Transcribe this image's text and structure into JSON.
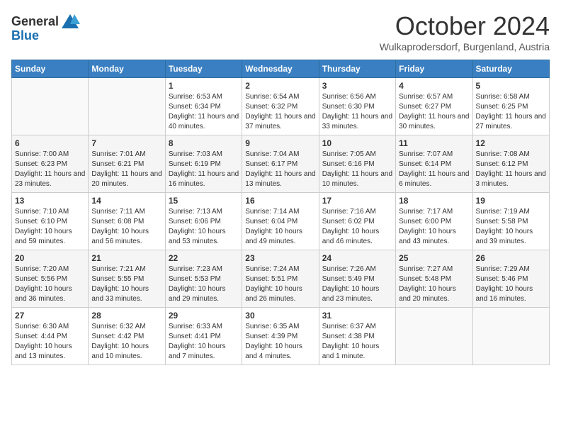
{
  "header": {
    "logo_general": "General",
    "logo_blue": "Blue",
    "month_title": "October 2024",
    "location": "Wulkaprodersdorf, Burgenland, Austria"
  },
  "days_of_week": [
    "Sunday",
    "Monday",
    "Tuesday",
    "Wednesday",
    "Thursday",
    "Friday",
    "Saturday"
  ],
  "weeks": [
    [
      {
        "date": "",
        "sunrise": "",
        "sunset": "",
        "daylight": ""
      },
      {
        "date": "",
        "sunrise": "",
        "sunset": "",
        "daylight": ""
      },
      {
        "date": "1",
        "sunrise": "Sunrise: 6:53 AM",
        "sunset": "Sunset: 6:34 PM",
        "daylight": "Daylight: 11 hours and 40 minutes."
      },
      {
        "date": "2",
        "sunrise": "Sunrise: 6:54 AM",
        "sunset": "Sunset: 6:32 PM",
        "daylight": "Daylight: 11 hours and 37 minutes."
      },
      {
        "date": "3",
        "sunrise": "Sunrise: 6:56 AM",
        "sunset": "Sunset: 6:30 PM",
        "daylight": "Daylight: 11 hours and 33 minutes."
      },
      {
        "date": "4",
        "sunrise": "Sunrise: 6:57 AM",
        "sunset": "Sunset: 6:27 PM",
        "daylight": "Daylight: 11 hours and 30 minutes."
      },
      {
        "date": "5",
        "sunrise": "Sunrise: 6:58 AM",
        "sunset": "Sunset: 6:25 PM",
        "daylight": "Daylight: 11 hours and 27 minutes."
      }
    ],
    [
      {
        "date": "6",
        "sunrise": "Sunrise: 7:00 AM",
        "sunset": "Sunset: 6:23 PM",
        "daylight": "Daylight: 11 hours and 23 minutes."
      },
      {
        "date": "7",
        "sunrise": "Sunrise: 7:01 AM",
        "sunset": "Sunset: 6:21 PM",
        "daylight": "Daylight: 11 hours and 20 minutes."
      },
      {
        "date": "8",
        "sunrise": "Sunrise: 7:03 AM",
        "sunset": "Sunset: 6:19 PM",
        "daylight": "Daylight: 11 hours and 16 minutes."
      },
      {
        "date": "9",
        "sunrise": "Sunrise: 7:04 AM",
        "sunset": "Sunset: 6:17 PM",
        "daylight": "Daylight: 11 hours and 13 minutes."
      },
      {
        "date": "10",
        "sunrise": "Sunrise: 7:05 AM",
        "sunset": "Sunset: 6:16 PM",
        "daylight": "Daylight: 11 hours and 10 minutes."
      },
      {
        "date": "11",
        "sunrise": "Sunrise: 7:07 AM",
        "sunset": "Sunset: 6:14 PM",
        "daylight": "Daylight: 11 hours and 6 minutes."
      },
      {
        "date": "12",
        "sunrise": "Sunrise: 7:08 AM",
        "sunset": "Sunset: 6:12 PM",
        "daylight": "Daylight: 11 hours and 3 minutes."
      }
    ],
    [
      {
        "date": "13",
        "sunrise": "Sunrise: 7:10 AM",
        "sunset": "Sunset: 6:10 PM",
        "daylight": "Daylight: 10 hours and 59 minutes."
      },
      {
        "date": "14",
        "sunrise": "Sunrise: 7:11 AM",
        "sunset": "Sunset: 6:08 PM",
        "daylight": "Daylight: 10 hours and 56 minutes."
      },
      {
        "date": "15",
        "sunrise": "Sunrise: 7:13 AM",
        "sunset": "Sunset: 6:06 PM",
        "daylight": "Daylight: 10 hours and 53 minutes."
      },
      {
        "date": "16",
        "sunrise": "Sunrise: 7:14 AM",
        "sunset": "Sunset: 6:04 PM",
        "daylight": "Daylight: 10 hours and 49 minutes."
      },
      {
        "date": "17",
        "sunrise": "Sunrise: 7:16 AM",
        "sunset": "Sunset: 6:02 PM",
        "daylight": "Daylight: 10 hours and 46 minutes."
      },
      {
        "date": "18",
        "sunrise": "Sunrise: 7:17 AM",
        "sunset": "Sunset: 6:00 PM",
        "daylight": "Daylight: 10 hours and 43 minutes."
      },
      {
        "date": "19",
        "sunrise": "Sunrise: 7:19 AM",
        "sunset": "Sunset: 5:58 PM",
        "daylight": "Daylight: 10 hours and 39 minutes."
      }
    ],
    [
      {
        "date": "20",
        "sunrise": "Sunrise: 7:20 AM",
        "sunset": "Sunset: 5:56 PM",
        "daylight": "Daylight: 10 hours and 36 minutes."
      },
      {
        "date": "21",
        "sunrise": "Sunrise: 7:21 AM",
        "sunset": "Sunset: 5:55 PM",
        "daylight": "Daylight: 10 hours and 33 minutes."
      },
      {
        "date": "22",
        "sunrise": "Sunrise: 7:23 AM",
        "sunset": "Sunset: 5:53 PM",
        "daylight": "Daylight: 10 hours and 29 minutes."
      },
      {
        "date": "23",
        "sunrise": "Sunrise: 7:24 AM",
        "sunset": "Sunset: 5:51 PM",
        "daylight": "Daylight: 10 hours and 26 minutes."
      },
      {
        "date": "24",
        "sunrise": "Sunrise: 7:26 AM",
        "sunset": "Sunset: 5:49 PM",
        "daylight": "Daylight: 10 hours and 23 minutes."
      },
      {
        "date": "25",
        "sunrise": "Sunrise: 7:27 AM",
        "sunset": "Sunset: 5:48 PM",
        "daylight": "Daylight: 10 hours and 20 minutes."
      },
      {
        "date": "26",
        "sunrise": "Sunrise: 7:29 AM",
        "sunset": "Sunset: 5:46 PM",
        "daylight": "Daylight: 10 hours and 16 minutes."
      }
    ],
    [
      {
        "date": "27",
        "sunrise": "Sunrise: 6:30 AM",
        "sunset": "Sunset: 4:44 PM",
        "daylight": "Daylight: 10 hours and 13 minutes."
      },
      {
        "date": "28",
        "sunrise": "Sunrise: 6:32 AM",
        "sunset": "Sunset: 4:42 PM",
        "daylight": "Daylight: 10 hours and 10 minutes."
      },
      {
        "date": "29",
        "sunrise": "Sunrise: 6:33 AM",
        "sunset": "Sunset: 4:41 PM",
        "daylight": "Daylight: 10 hours and 7 minutes."
      },
      {
        "date": "30",
        "sunrise": "Sunrise: 6:35 AM",
        "sunset": "Sunset: 4:39 PM",
        "daylight": "Daylight: 10 hours and 4 minutes."
      },
      {
        "date": "31",
        "sunrise": "Sunrise: 6:37 AM",
        "sunset": "Sunset: 4:38 PM",
        "daylight": "Daylight: 10 hours and 1 minute."
      },
      {
        "date": "",
        "sunrise": "",
        "sunset": "",
        "daylight": ""
      },
      {
        "date": "",
        "sunrise": "",
        "sunset": "",
        "daylight": ""
      }
    ]
  ]
}
